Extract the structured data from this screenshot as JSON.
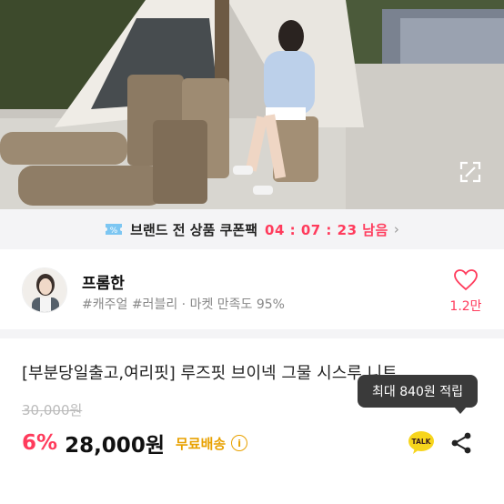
{
  "hero": {
    "expand_icon": "expand-icon"
  },
  "coupon": {
    "icon": "coupon-icon",
    "text": "브랜드 전 상품 쿠폰팩",
    "timer": "04 : 07 : 23 남음",
    "chevron": "›"
  },
  "shop": {
    "name": "프롬한",
    "tag1": "#캐주얼",
    "tag2": "#러블리",
    "sep": " · ",
    "satisfaction": "마켓 만족도 95%",
    "like_count": "1.2만"
  },
  "product": {
    "title": "[부분당일출고,여리핏] 루즈핏 브이넥 그물 시스루 니트",
    "original_price": "30,000원",
    "discount": "6%",
    "price": "28,000원",
    "shipping": "무료배송",
    "info_icon": "i"
  },
  "tooltip": {
    "text": "최대 840원 적립"
  },
  "actions": {
    "talk_label": "TALK"
  },
  "colors": {
    "accent": "#ff3b5c",
    "shipping": "#e8a100",
    "kakao": "#3a1d1d"
  }
}
